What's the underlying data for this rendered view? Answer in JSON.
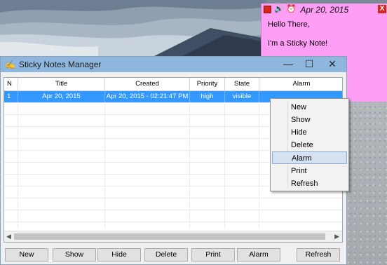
{
  "sticky_note": {
    "date": "Apr 20, 2015",
    "line1": "Hello There,",
    "line2": "I'm a Sticky Note!",
    "close_glyph": "X",
    "icons": [
      "speaker-icon",
      "alarm-clock-icon"
    ]
  },
  "window": {
    "title": "Sticky Notes Manager",
    "controls": {
      "minimize": "—",
      "maximize": "☐",
      "close": "✕"
    }
  },
  "table": {
    "columns": [
      "N",
      "Title",
      "Created",
      "Priority",
      "State",
      "Alarm"
    ],
    "rows": [
      {
        "n": "1",
        "title": "Apr 20, 2015",
        "created": "Apr 20, 2015 - 02:21:47 PM",
        "priority": "high",
        "state": "visible",
        "alarm": ""
      }
    ],
    "selected_row": 0
  },
  "buttons": [
    "New",
    "Show",
    "Hide",
    "Delete",
    "Print",
    "Alarm",
    "Refresh"
  ],
  "context_menu": {
    "items": [
      "New",
      "Show",
      "Hide",
      "Delete",
      "Alarm",
      "Print",
      "Refresh"
    ],
    "highlighted": "Alarm"
  },
  "colors": {
    "note_bg": "#ff9ef5",
    "selection": "#3399ff",
    "titlebar": "#8fb6dc",
    "menu_highlight": "#d5e1f0"
  }
}
